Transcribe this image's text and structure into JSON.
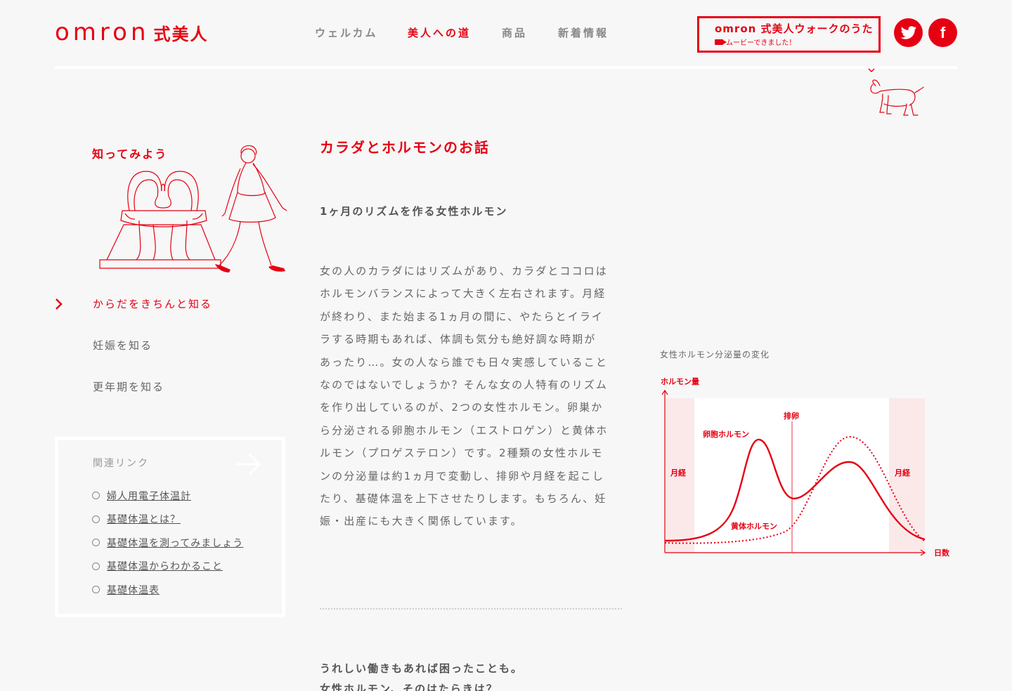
{
  "header": {
    "logo_word": "omron",
    "logo_kanji": "式美人",
    "nav": [
      {
        "label": "ウェルカム",
        "active": false
      },
      {
        "label": "美人への道",
        "active": true
      },
      {
        "label": "商品",
        "active": false
      },
      {
        "label": "新着情報",
        "active": false
      }
    ],
    "banner": {
      "line1": "omron 式美人ウォークのうた",
      "line2": "ムービーできました！",
      "icon": "video-camera-icon"
    },
    "social": [
      {
        "name": "twitter",
        "icon": "twitter-bird-icon"
      },
      {
        "name": "facebook",
        "glyph": "f",
        "icon": "facebook-icon"
      }
    ]
  },
  "sidebar": {
    "title": "知ってみよう",
    "menu": [
      {
        "label": "からだをきちんと知る",
        "active": true
      },
      {
        "label": "妊娠を知る",
        "active": false
      },
      {
        "label": "更年期を知る",
        "active": false
      }
    ],
    "related": {
      "title": "関連リンク",
      "links": [
        "婦人用電子体温計",
        "基礎体温とは？",
        "基礎体温を測ってみましょう",
        "基礎体温からわかること",
        "基礎体温表"
      ]
    }
  },
  "main": {
    "title": "カラダとホルモンのお話",
    "subtitle": "1ヶ月のリズムを作る女性ホルモン",
    "lines": [
      "女の人のカラダにはリズムがあり、カラダとココロは",
      "ホルモンバランスによって大きく左右されます。月経",
      "が終わり、また始まる1ヵ月の間に、やたらとイライ",
      "ラする時期もあれば、体調も気分も絶好調な時期が",
      "あったり…。女の人なら誰でも日々実感していること",
      "なのではないでしょうか？そんな女の人特有のリズム",
      "を作り出しているのが、2つの女性ホルモン。卵巣か",
      "ら分泌される卵胞ホルモン（エストロゲン）と黄体ホ",
      "ルモン（プロゲステロン）です。2種類の女性ホルモ",
      "ンの分泌量は約1ヵ月で変動し、排卵や月経を起こし",
      "たり、基礎体温を上下させたりします。もちろん、妊",
      "娠・出産にも大きく関係しています。"
    ],
    "subtitle2_line1": "うれしい働きもあれば困ったことも。",
    "subtitle2_line2": "女性ホルモン、そのはたらきは？"
  },
  "chart": {
    "caption": "女性ホルモン分泌量の変化",
    "colors": {
      "accent": "#e60012",
      "band": "#fbe9ea"
    }
  },
  "chart_data": {
    "type": "line",
    "ylabel": "ホルモン量",
    "xlabel": "日数",
    "annotations": [
      "月経",
      "排卵",
      "月経"
    ],
    "series": [
      {
        "name": "卵胞ホルモン",
        "style": "solid"
      },
      {
        "name": "黄体ホルモン",
        "style": "dotted"
      }
    ]
  }
}
